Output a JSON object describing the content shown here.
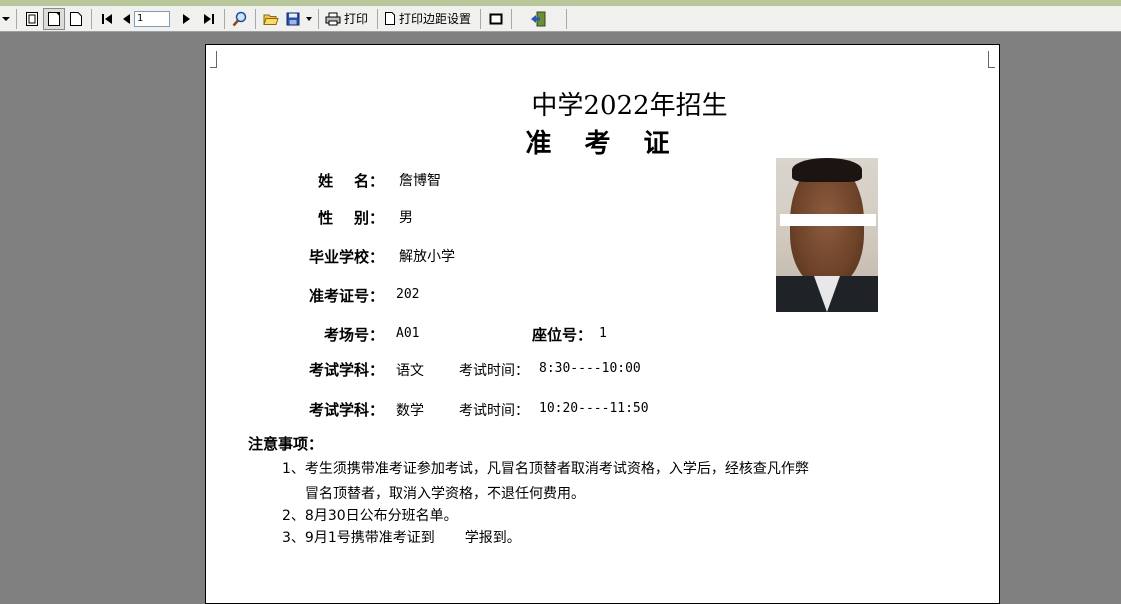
{
  "toolbar": {
    "page_value": "1",
    "print_label": "打印",
    "margin_label": "打印边距设置"
  },
  "doc": {
    "title_suffix": "中学2022年招生",
    "title2": "准 考 证",
    "fields": {
      "name_label": "姓    名：",
      "name_value": "詹博智",
      "gender_label": "性    别：",
      "gender_value": "男",
      "school_label": "毕业学校：",
      "school_value": "解放小学",
      "ticket_label": "准考证号：",
      "ticket_value": "202",
      "room_label": "考场号：",
      "room_value": "A01",
      "seat_label": "座位号：",
      "seat_value": "1",
      "subject1_label": "考试学科：",
      "subject1_value": "语文",
      "time1_label": "考试时间：",
      "time1_value": "8:30----10:00",
      "subject2_label": "考试学科：",
      "subject2_value": "数学",
      "time2_label": "考试时间：",
      "time2_value": "10:20----11:50"
    },
    "notes": {
      "title": "注意事项：",
      "item1_line1": "1、考生须携带准考证参加考试，凡冒名顶替者取消考试资格，入学后，经核查凡作弊",
      "item1_line2": "冒名顶替者，取消入学资格，不退任何费用。",
      "item2": "2、8月30日公布分班名单。",
      "item3_pre": "3、9月1号携带准考证到",
      "item3_post": "学报到。"
    }
  }
}
